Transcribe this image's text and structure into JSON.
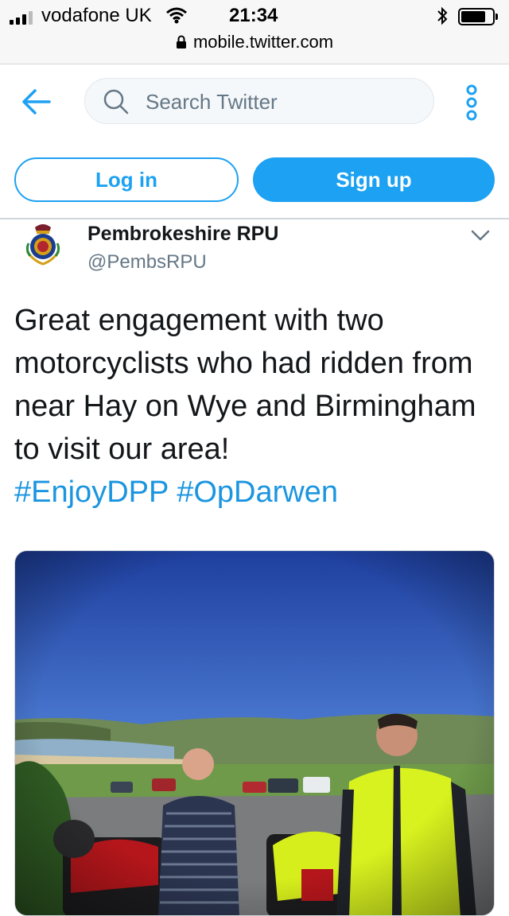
{
  "status_bar": {
    "carrier": "vodafone UK",
    "time": "21:34",
    "url": "mobile.twitter.com",
    "icons": [
      "signal-icon",
      "wifi-icon",
      "bluetooth-icon",
      "battery-icon",
      "lock-icon"
    ]
  },
  "header": {
    "search_placeholder": "Search Twitter",
    "icons": [
      "back-arrow-icon",
      "search-icon",
      "more-options-icon"
    ]
  },
  "auth": {
    "login_label": "Log in",
    "signup_label": "Sign up"
  },
  "tweet": {
    "display_name": "Pembrokeshire RPU",
    "handle": "@PembsRPU",
    "text": "Great engagement with two motorcyclists who had ridden from near Hay on Wye and Birmingham to visit our area!",
    "hashtags": [
      "#EnjoyDPP",
      "#OpDarwen"
    ]
  },
  "colors": {
    "accent": "#1da1f2",
    "link": "#1b95e0",
    "secondary_text": "#657786"
  }
}
